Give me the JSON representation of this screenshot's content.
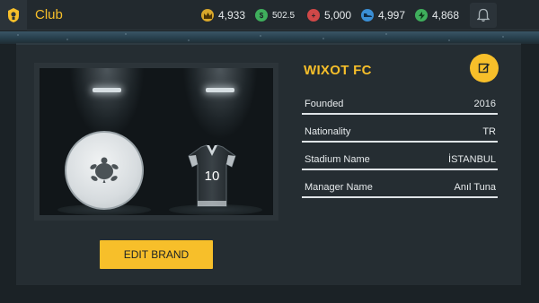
{
  "header": {
    "title": "Club",
    "home_icon": "club-crest-icon",
    "notification_icon": "bell-icon"
  },
  "currencies": [
    {
      "icon": "crown-coin-icon",
      "color": "#d9a72a",
      "value": "4,933"
    },
    {
      "icon": "dollar-coin-icon",
      "color": "#3fae5c",
      "value": "502.5"
    },
    {
      "icon": "plus-coin-icon",
      "color": "#d04848",
      "value": "5,000"
    },
    {
      "icon": "shoe-coin-icon",
      "color": "#3a8fd6",
      "value": "4,997"
    },
    {
      "icon": "bolt-coin-icon",
      "color": "#3fae5c",
      "value": "4,868"
    }
  ],
  "club": {
    "name": "WIXOT FC",
    "edit_icon": "pencil-icon",
    "jersey_number": "10",
    "badge_icon": "turtle-icon"
  },
  "info": [
    {
      "label": "Founded",
      "value": "2016"
    },
    {
      "label": "Nationality",
      "value": "TR"
    },
    {
      "label": "Stadium Name",
      "value": "İSTANBUL"
    },
    {
      "label": "Manager Name",
      "value": "Anıl Tuna"
    }
  ],
  "actions": {
    "edit_brand_label": "EDIT BRAND"
  },
  "colors": {
    "accent": "#f7bf2a",
    "panel": "#252d32",
    "background": "#1b2226"
  }
}
